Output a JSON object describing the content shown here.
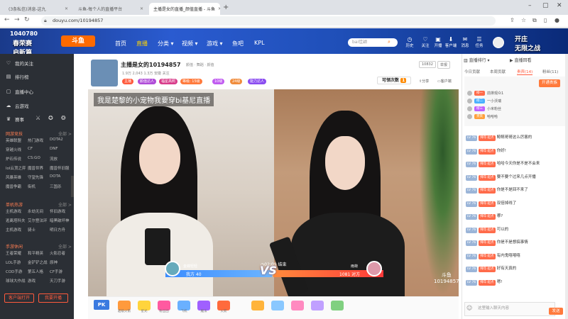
{
  "browser": {
    "tabs": [
      "斗鱼-每个人的直播平台",
      "斗鱼-每个人的直播平台",
      "主播是女的直播_颜值直播 - 斗鱼"
    ],
    "tab_first_partial": "(3条私信)消息-这九",
    "url": "douyu.com/10194857"
  },
  "header": {
    "room_num_top": "1040780",
    "promo_left": "春荣赛",
    "promo_left_sub": "启新篇",
    "logo": "斗鱼",
    "nav": [
      "首页",
      "直播",
      "分类",
      "视频",
      "游戏",
      "鱼吧",
      "KPL"
    ],
    "search_placeholder": "bai佳颖",
    "icons": [
      {
        "label": "历史",
        "icon": "clock-icon"
      },
      {
        "label": "关注",
        "icon": "heart-icon"
      },
      {
        "label": "开播",
        "icon": "camera-icon"
      },
      {
        "label": "客户端",
        "icon": "download-icon"
      },
      {
        "label": "消息",
        "icon": "bell-icon"
      },
      {
        "label": "任务",
        "icon": "task-icon"
      }
    ],
    "promo_right": "开庄",
    "promo_right_sub": "无限之战"
  },
  "sidebar": {
    "items": [
      {
        "label": "我的关注",
        "icon": "heart-icon"
      },
      {
        "label": "排行榜",
        "icon": "rank-icon"
      },
      {
        "label": "直播中心",
        "icon": "center-icon"
      },
      {
        "label": "云游戏",
        "icon": "cloud-icon"
      },
      {
        "label": "赛事",
        "icon": "trophy-icon"
      }
    ],
    "sections": [
      {
        "title": "网游竞技",
        "more": "全部 >",
        "grid": [
          "英雄联盟",
          "热门游戏",
          "DOTA2",
          "穿越火线",
          "CF",
          "DNF",
          "炉石传说",
          "CS:GO",
          "流放",
          "lol云顶之弈",
          "魔兽世界",
          "魔兽怀旧服",
          "风暴英雄",
          "守望先锋",
          "DOTA",
          "魔兽争霸",
          "街机",
          "三国杀"
        ]
      },
      {
        "title": "单机热游",
        "more": "全部 >",
        "grid": [
          "主机游戏",
          "永劫无间",
          "怀旧游戏",
          "逃离塔科夫",
          "艾尔登法环",
          "暗黑破坏神",
          "主机游戏",
          "骑士",
          "明日方舟"
        ]
      },
      {
        "title": "手游休闲",
        "more": "全部 >",
        "grid": [
          "王者荣耀",
          "和平精英",
          "火影忍者",
          "LOL手游",
          "金铲铲之战",
          "原神",
          "COD手游",
          "第五人格",
          "CF手游",
          "球球大作战",
          "游戏",
          "天刀手游"
        ]
      }
    ],
    "btn_client": "客户端打开",
    "btn_stream": "我要开播"
  },
  "room": {
    "title": "主播是女的10194857",
    "category_path": "颜值 · 舞蹈 · 颜值",
    "meta": "1.9万  2,043  1.3万  安徽  关注",
    "badges": [
      {
        "text": "主播",
        "color": "#ff5a3c"
      },
      {
        "text": "颜值达人",
        "color": "#b04cd8"
      },
      {
        "text": "福星高照",
        "color": "#d83c8a"
      },
      {
        "text": "等级: 15级",
        "color": "#ff7a3c"
      },
      {
        "text": "10级",
        "color": "#c05bf0"
      },
      {
        "text": "24级",
        "color": "#f08c3c"
      },
      {
        "text": "能力达人",
        "color": "#8a4cf0"
      }
    ],
    "report": "举报",
    "follow_label": "可领次数",
    "follow_count": "1",
    "tools": [
      "分享",
      "客户端",
      "清晰度"
    ],
    "room_id_box": "10832"
  },
  "video": {
    "overlay_title": "我是楚黎的小宠物我要穿bi基尼直播",
    "pk_timer": "02:09",
    "pk_status": "结束",
    "pk_left_label": "我方 40",
    "pk_right_label": "1081 对方",
    "pk_left_name": "金蝶轻轻",
    "pk_right_name": "雨荷",
    "watermark_top": "斗鱼",
    "watermark_bottom": "10194857"
  },
  "gifts": [
    {
      "label": "PK",
      "color": "#3a7ae0",
      "icon": "pk-icon"
    },
    {
      "label": "超级火箭",
      "color": "#ff9a3c",
      "icon": "rocket-icon"
    },
    {
      "label": "星光",
      "color": "#ffd43c",
      "icon": "star-icon"
    },
    {
      "label": "粉丝团",
      "color": "#ff5aa0",
      "icon": "fans-icon"
    },
    {
      "label": "飞机",
      "color": "#6ab0ff",
      "icon": "plane-icon"
    },
    {
      "label": "魔法",
      "color": "#a060ff",
      "icon": "magic-icon"
    },
    {
      "label": "火箭",
      "color": "#ff6a3c",
      "icon": "fire-icon"
    },
    {
      "label": "",
      "color": "#ffb43c",
      "icon": "gift-icon"
    },
    {
      "label": "",
      "color": "#8ac8ff",
      "icon": "gift-icon"
    },
    {
      "label": "",
      "color": "#ff8ac0",
      "icon": "gift-icon"
    },
    {
      "label": "",
      "color": "#c0a0ff",
      "icon": "gift-icon"
    },
    {
      "label": "",
      "color": "#80d080",
      "icon": "gift-icon"
    }
  ],
  "right": {
    "top": "直播排行",
    "top_tab": "直播回看",
    "tabs": [
      "今日贡献",
      "本周贡献",
      "贵宾(14)",
      "粉丝(11)"
    ],
    "open_btn": "开通贵族",
    "ranks": [
      {
        "chip": "榜一",
        "name": "前排观众1",
        "chip_color": "#ff6b4a"
      },
      {
        "chip": "榜二",
        "name": "一小沃瑞",
        "chip_color": "#4ab0ff"
      },
      {
        "chip": "榜三",
        "name": "小米粉丝",
        "chip_color": "#c060ff"
      },
      {
        "chip": "贵宾",
        "name": "哈哈哈",
        "chip_color": "#ffa03c"
      }
    ],
    "chat": [
      {
        "lv": "LV 76",
        "tag": "拜年·起点",
        "text": "鲸鲸哥哥这么厉害的"
      },
      {
        "lv": "LV 76",
        "tag": "拜年·起点",
        "text": "你好!"
      },
      {
        "lv": "LV 76",
        "tag": "拜年·起点",
        "text": "哈哈今天你是不是不会来"
      },
      {
        "lv": "LV 76",
        "tag": "拜年·起点",
        "text": "要不要个过来几点开播"
      },
      {
        "lv": "LV 76",
        "tag": "拜年·起点",
        "text": "你是不是回不来了"
      },
      {
        "lv": "LV 76",
        "tag": "拜年·起点",
        "text": "双倍掉线了"
      },
      {
        "lv": "LV 76",
        "tag": "拜年·起点",
        "text": "哪?"
      },
      {
        "lv": "LV 76",
        "tag": "拜年·起点",
        "text": "可以的"
      },
      {
        "lv": "LV 76",
        "tag": "拜年·起点",
        "text": "你是不是想搞事情"
      },
      {
        "lv": "LV 76",
        "tag": "拜年·起点",
        "text": "有内鬼嘻嘻嘻"
      },
      {
        "lv": "LV 76",
        "tag": "拜年·起点",
        "text": "好有天真的"
      },
      {
        "lv": "LV 76",
        "tag": "拜年·起点",
        "text": "嗯!"
      }
    ],
    "input_placeholder": "这里输入聊天内容",
    "send_label": "发送"
  }
}
